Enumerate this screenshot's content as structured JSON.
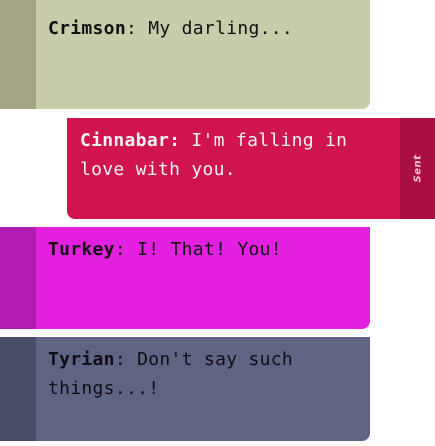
{
  "messages": [
    {
      "sender": "Crimson",
      "separator": ":",
      "text": " My darling..."
    },
    {
      "sender": "Cinnabar",
      "separator": ":",
      "text": " I'm falling in love with you.",
      "status": "Sent"
    },
    {
      "sender": "Turkey",
      "separator": ":",
      "text": " I! That! You!"
    },
    {
      "sender": "Tyrian",
      "separator": ":",
      "text": " Don't say such things...!"
    }
  ],
  "colors": {
    "crimson_bubble": "#c8ccaa",
    "cinnabar_bubble": "#cf1450",
    "turkey_bubble": "#e31fe0",
    "tyrian_bubble": "#5f6483"
  }
}
